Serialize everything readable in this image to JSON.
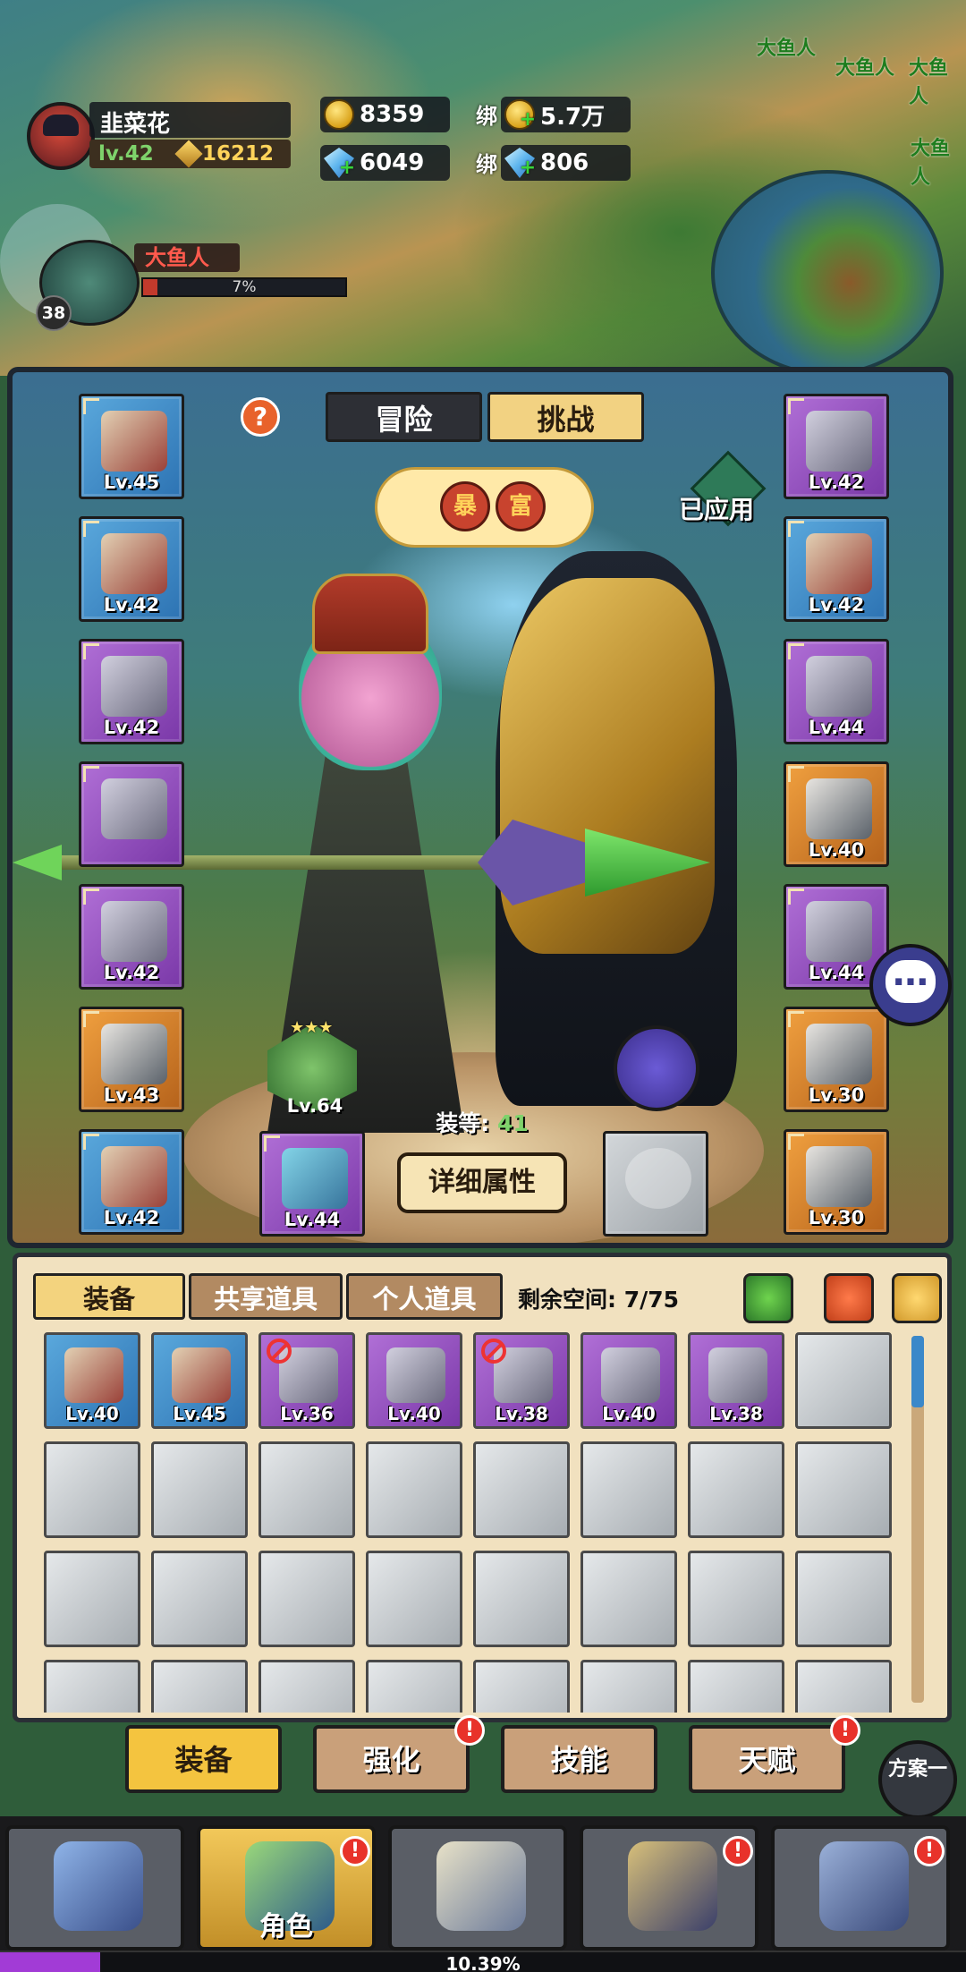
{
  "map": {
    "labels": [
      "大鱼人",
      "大鱼人",
      "大鱼人",
      "大鱼人"
    ]
  },
  "player": {
    "name": "韭菜花",
    "level": "lv.42",
    "power": "16212"
  },
  "resources": {
    "gold": "8359",
    "gems": "6049",
    "bound_label": "绑",
    "bound_gold": "5.7万",
    "bound_gems": "806"
  },
  "target": {
    "name": "大鱼人",
    "progress_text": "7%",
    "progress": 0.07,
    "level": "38"
  },
  "character": {
    "tabs": [
      "冒险",
      "挑战"
    ],
    "active_tab": "挑战",
    "help": "?",
    "applied_label": "已应用",
    "badge_chars": [
      "暴",
      "富"
    ],
    "armor_level": "Lv.64",
    "gear_score_label": "装等:",
    "gear_score": "41",
    "detail_button": "详细属性",
    "weapon_level": "Lv.44"
  },
  "left_slots": [
    {
      "level": "Lv.45",
      "rarity": "blue",
      "icon": "crown-helmet-icon"
    },
    {
      "level": "Lv.42",
      "rarity": "blue",
      "icon": "necklace-icon"
    },
    {
      "level": "Lv.42",
      "rarity": "purple",
      "icon": "shoulder-armor-icon"
    },
    {
      "level": "",
      "rarity": "purple",
      "icon": "robe-armor-icon"
    },
    {
      "level": "Lv.42",
      "rarity": "purple",
      "icon": "cape-icon"
    },
    {
      "level": "Lv.43",
      "rarity": "orange",
      "icon": "bracer-icon"
    },
    {
      "level": "Lv.42",
      "rarity": "blue",
      "icon": "gauntlet-icon"
    }
  ],
  "right_slots": [
    {
      "level": "Lv.42",
      "rarity": "purple",
      "icon": "belt-icon"
    },
    {
      "level": "Lv.42",
      "rarity": "blue",
      "icon": "pants-icon"
    },
    {
      "level": "Lv.44",
      "rarity": "purple",
      "icon": "boots-icon"
    },
    {
      "level": "Lv.40",
      "rarity": "orange",
      "icon": "ring-gem-icon"
    },
    {
      "level": "Lv.44",
      "rarity": "purple",
      "icon": "ring-icon"
    },
    {
      "level": "Lv.30",
      "rarity": "orange",
      "icon": "star-amulet-icon"
    },
    {
      "level": "Lv.30",
      "rarity": "orange",
      "icon": "heart-amulet-icon"
    }
  ],
  "inventory": {
    "tabs": [
      "装备",
      "共享道具",
      "个人道具"
    ],
    "active_tab": "装备",
    "space_label": "剩余空间: 7/75",
    "items": [
      {
        "level": "Lv.40",
        "rarity": "blue",
        "icon": "boots-icon",
        "banned": false
      },
      {
        "level": "Lv.45",
        "rarity": "blue",
        "icon": "shoulder-armor-icon",
        "banned": false
      },
      {
        "level": "Lv.36",
        "rarity": "purple",
        "icon": "bow-icon",
        "banned": true
      },
      {
        "level": "Lv.40",
        "rarity": "purple",
        "icon": "pants-icon",
        "banned": false
      },
      {
        "level": "Lv.38",
        "rarity": "purple",
        "icon": "shoulder-armor-icon",
        "banned": true
      },
      {
        "level": "Lv.40",
        "rarity": "purple",
        "icon": "boots-icon",
        "banned": false
      },
      {
        "level": "Lv.38",
        "rarity": "purple",
        "icon": "bracer-icon",
        "banned": false
      }
    ],
    "empty_cells": 25
  },
  "sub_tabs": [
    {
      "label": "装备",
      "active": true,
      "alert": false
    },
    {
      "label": "强化",
      "active": false,
      "alert": true
    },
    {
      "label": "技能",
      "active": false,
      "alert": false
    },
    {
      "label": "天赋",
      "active": false,
      "alert": true
    }
  ],
  "plan_button": "方案一",
  "alert_mark": "!",
  "bottom_nav": [
    {
      "label": "",
      "icon": "rune-stone-icon",
      "active": false,
      "alert": false
    },
    {
      "label": "角色",
      "icon": "hooded-character-icon",
      "active": true,
      "alert": true
    },
    {
      "label": "",
      "icon": "battle-skull-icon",
      "active": false,
      "alert": false
    },
    {
      "label": "",
      "icon": "shrine-icon",
      "active": false,
      "alert": true
    },
    {
      "label": "",
      "icon": "castle-icon",
      "active": false,
      "alert": true
    }
  ],
  "xp": {
    "text": "10.39%",
    "progress": 0.1039
  },
  "colors": {
    "rarity_blue": "#3d8fd0",
    "rarity_purple": "#9a52c6",
    "rarity_orange": "#e2882f",
    "alert_red": "#e8322a",
    "active_gold": "#f4c43f"
  }
}
